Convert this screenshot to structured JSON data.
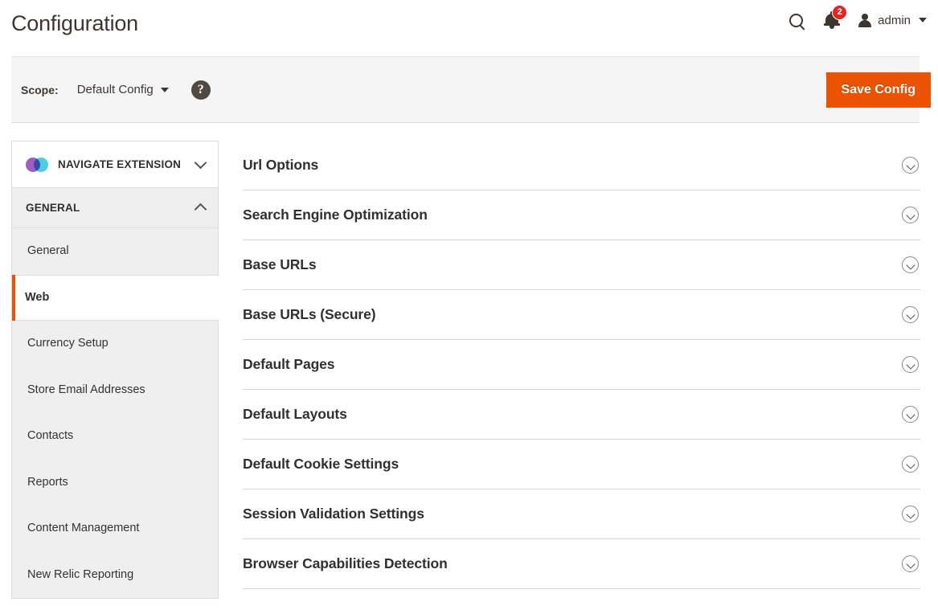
{
  "header": {
    "title": "Configuration",
    "search_icon": "search-icon",
    "notifications": {
      "icon": "bell-icon",
      "count": "2"
    },
    "user": {
      "icon": "user-icon",
      "name": "admin",
      "caret": "caret-down-icon"
    }
  },
  "scope_bar": {
    "label": "Scope:",
    "value": "Default Config",
    "caret": "caret-down-icon",
    "help_icon": "question-mark-icon",
    "help_glyph": "?",
    "save_label": "Save Config"
  },
  "sidebar": {
    "extension": {
      "title": "NAVIGATE EXTENSION",
      "logo": "navigate-extension-logo",
      "toggle_icon": "chevron-down-icon"
    },
    "group": {
      "title": "GENERAL",
      "toggle_icon": "chevron-up-icon"
    },
    "items": [
      {
        "label": "General",
        "active": false
      },
      {
        "label": "Web",
        "active": true
      },
      {
        "label": "Currency Setup",
        "active": false
      },
      {
        "label": "Store Email Addresses",
        "active": false
      },
      {
        "label": "Contacts",
        "active": false
      },
      {
        "label": "Reports",
        "active": false
      },
      {
        "label": "Content Management",
        "active": false
      },
      {
        "label": "New Relic Reporting",
        "active": false
      }
    ]
  },
  "main": {
    "sections": [
      {
        "title": "Url Options",
        "toggle_icon": "chevron-down-circle-icon"
      },
      {
        "title": "Search Engine Optimization",
        "toggle_icon": "chevron-down-circle-icon"
      },
      {
        "title": "Base URLs",
        "toggle_icon": "chevron-down-circle-icon"
      },
      {
        "title": "Base URLs (Secure)",
        "toggle_icon": "chevron-down-circle-icon"
      },
      {
        "title": "Default Pages",
        "toggle_icon": "chevron-down-circle-icon"
      },
      {
        "title": "Default Layouts",
        "toggle_icon": "chevron-down-circle-icon"
      },
      {
        "title": "Default Cookie Settings",
        "toggle_icon": "chevron-down-circle-icon"
      },
      {
        "title": "Session Validation Settings",
        "toggle_icon": "chevron-down-circle-icon"
      },
      {
        "title": "Browser Capabilities Detection",
        "toggle_icon": "chevron-down-circle-icon"
      }
    ]
  },
  "colors": {
    "accent_orange": "#eb5202",
    "badge_red": "#e22626",
    "text_dark": "#41362f",
    "panel_gray": "#efefef",
    "scope_bg": "#f5f5f5",
    "logo_purple": "#a05fc0",
    "logo_cyan": "#4ecde0"
  }
}
